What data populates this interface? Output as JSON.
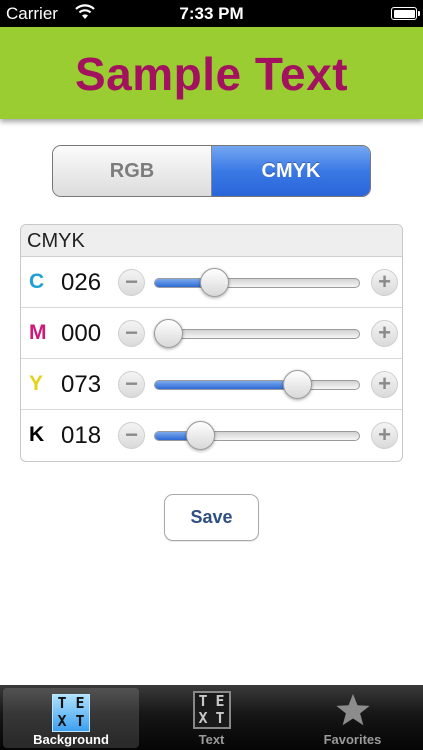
{
  "status_bar": {
    "carrier": "Carrier",
    "time": "7:33 PM"
  },
  "header": {
    "title": "Sample Text",
    "title_color": "#a3125f",
    "background": "#9acd32"
  },
  "mode": {
    "options": [
      "RGB",
      "CMYK"
    ],
    "selected": "CMYK"
  },
  "cmyk": {
    "section_title": "CMYK",
    "channels": [
      {
        "letter": "C",
        "value": "026",
        "level": 26,
        "color": "#1e9fd6"
      },
      {
        "letter": "M",
        "value": "000",
        "level": 0,
        "color": "#cc1a7a"
      },
      {
        "letter": "Y",
        "value": "073",
        "level": 73,
        "color": "#e6d21a"
      },
      {
        "letter": "K",
        "value": "018",
        "level": 18,
        "color": "#000000"
      }
    ],
    "minus_label": "−",
    "plus_label": "+"
  },
  "save_label": "Save",
  "tabs": [
    {
      "label": "Background",
      "icon": "text-box-icon",
      "icon_glyphs": [
        "T",
        "E",
        "X",
        "T"
      ],
      "active": true
    },
    {
      "label": "Text",
      "icon": "text-box-icon",
      "icon_glyphs": [
        "T",
        "E",
        "X",
        "T"
      ],
      "active": false
    },
    {
      "label": "Favorites",
      "icon": "star-icon",
      "active": false
    }
  ]
}
